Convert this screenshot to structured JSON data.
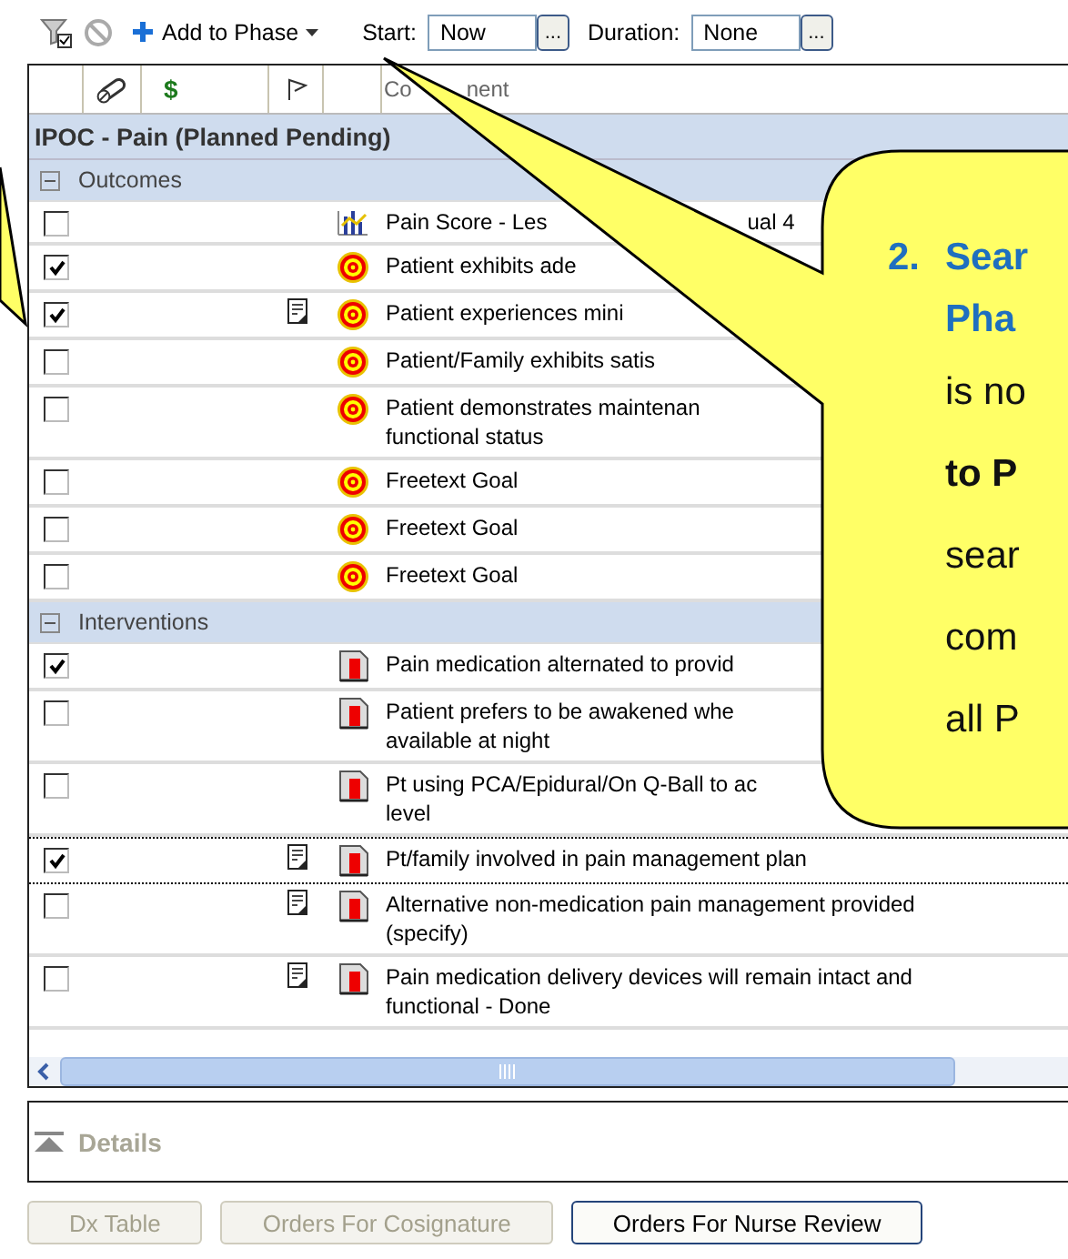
{
  "toolbar": {
    "add_label": "Add to Phase",
    "start_label": "Start:",
    "start_value": "Now",
    "start_button": "...",
    "duration_label": "Duration:",
    "duration_value": "None",
    "duration_button": "..."
  },
  "table": {
    "columns": [
      {
        "kind": "pill"
      },
      {
        "kind": "text",
        "text": "$"
      },
      {
        "kind": "flag"
      },
      {
        "kind": "blank"
      },
      {
        "kind": "text",
        "text": "Co",
        "tail": "nent"
      }
    ],
    "plan": "IPOC - Pain (Planned Pending)",
    "groups": [
      {
        "label": "Outcomes",
        "expanded": true,
        "rows": [
          {
            "checked": false,
            "note": false,
            "kind": "chart",
            "focused": false,
            "lines": [
              "Pain Score - Les"
            ],
            "tail": "ual 4"
          },
          {
            "checked": true,
            "note": false,
            "kind": "target",
            "focused": false,
            "lines": [
              "Patient exhibits ade"
            ]
          },
          {
            "checked": true,
            "note": true,
            "kind": "target",
            "focused": false,
            "lines": [
              "Patient experiences mini"
            ]
          },
          {
            "checked": false,
            "note": false,
            "kind": "target",
            "focused": false,
            "lines": [
              "Patient/Family exhibits satis"
            ]
          },
          {
            "checked": false,
            "note": false,
            "kind": "target",
            "focused": false,
            "lines": [
              "Patient demonstrates maintenan",
              "functional status"
            ]
          },
          {
            "checked": false,
            "note": false,
            "kind": "target",
            "focused": false,
            "lines": [
              "Freetext Goal"
            ]
          },
          {
            "checked": false,
            "note": false,
            "kind": "target",
            "focused": false,
            "lines": [
              "Freetext Goal"
            ]
          },
          {
            "checked": false,
            "note": false,
            "kind": "target",
            "focused": false,
            "lines": [
              "Freetext Goal"
            ]
          }
        ]
      },
      {
        "label": "Interventions",
        "expanded": true,
        "rows": [
          {
            "checked": true,
            "note": false,
            "kind": "order",
            "focused": false,
            "lines": [
              "Pain medication alternated to provid"
            ]
          },
          {
            "checked": false,
            "note": false,
            "kind": "order",
            "focused": false,
            "lines": [
              "Patient prefers to be awakened whe",
              "available at night"
            ]
          },
          {
            "checked": false,
            "note": false,
            "kind": "order",
            "focused": false,
            "lines": [
              "Pt using PCA/Epidural/On Q-Ball to ac",
              "level"
            ]
          },
          {
            "checked": true,
            "note": true,
            "kind": "order",
            "focused": true,
            "lines": [
              "Pt/family involved in pain management plan"
            ]
          },
          {
            "checked": false,
            "note": true,
            "kind": "order",
            "focused": false,
            "lines": [
              "Alternative non-medication pain management provided",
              "(specify)"
            ]
          },
          {
            "checked": false,
            "note": true,
            "kind": "order",
            "focused": false,
            "lines": [
              "Pain medication delivery devices will remain intact and",
              "functional - Done"
            ]
          }
        ]
      }
    ]
  },
  "details": {
    "label": "Details",
    "expanded": false
  },
  "buttons": [
    {
      "label": "Dx Table",
      "disabled": true
    },
    {
      "label": "Orders For Cosignature",
      "disabled": true
    },
    {
      "label": "Orders For Nurse Review",
      "disabled": false
    }
  ],
  "callout": {
    "number": "2.",
    "lines": [
      {
        "kind": "heading",
        "text": "Sear"
      },
      {
        "kind": "heading",
        "text": "Pha"
      },
      {
        "kind": "plain",
        "text": "is no"
      },
      {
        "kind": "bold",
        "text": "to P"
      },
      {
        "kind": "plain",
        "text": "sear"
      },
      {
        "kind": "plain",
        "text": "com"
      },
      {
        "kind": "plain",
        "text": "all P"
      }
    ]
  }
}
